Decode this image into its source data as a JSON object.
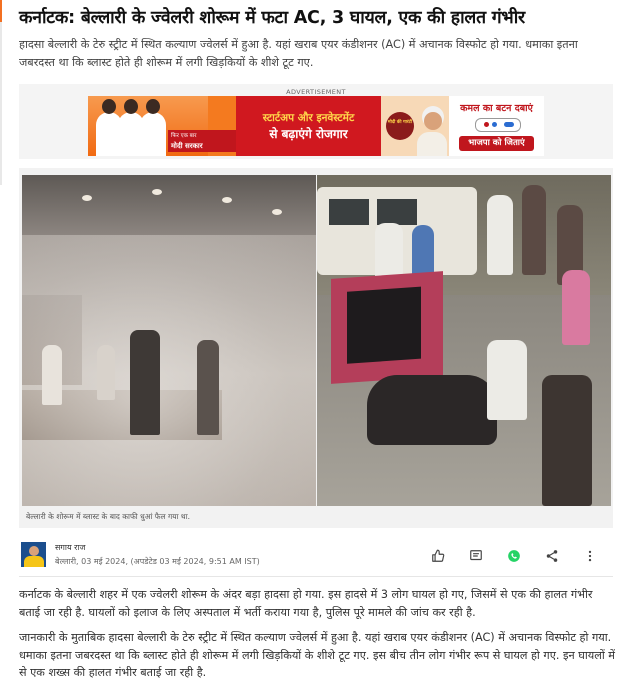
{
  "article": {
    "headline": "कर्नाटक: बेल्लारी के ज्वेलरी शोरूम में फटा AC, 3 घायल, एक की हालत गंभीर",
    "summary": "हादसा बेल्लारी के टेरु स्ट्रीट में स्थित कल्याण ज्वेलर्स में हुआ है. यहां खराब एयर कंडीशनर (AC) में अचानक विस्फोट हो गया. धमाका इतना जबरदस्त था कि ब्लास्ट होते ही शोरूम में लगी खिड़कियों के शीशे टूट गए.",
    "image_caption": "बेल्लारी के शोरूम में ब्लास्ट के बाद काफी धुआं फैल गया था.",
    "author": "सगाय राज",
    "dateline": "बेल्लारी, 03 मई 2024, (अपडेटेड 03 मई 2024, 9:51 AM IST)",
    "paragraphs": [
      "कर्नाटक के बेल्लारी शहर में एक ज्वेलरी शोरूम के अंदर बड़ा हादसा हो गया. इस हादसे में 3 लोग घायल हो गए, जिसमें से एक की हालत गंभीर बताई जा रही है. घायलों को इलाज के लिए अस्पताल में भर्ती कराया गया है, पुलिस पूरे मामले की जांच कर रही है.",
      "जानकारी के मुताबिक हादसा बेल्लारी के टेरु स्ट्रीट में स्थित कल्याण ज्वेलर्स में हुआ है. यहां खराब एयर कंडीशनर (AC) में अचानक विस्फोट हो गया. धमाका इतना जबरदस्त था कि ब्लास्ट होते ही शोरूम में लगी खिड़कियों के शीशे टूट गए. इस बीच तीन लोग गंभीर रूप से घायल हो गए. इन घायलों में से एक शख्स की हालत गंभीर बताई जा रही है."
    ]
  },
  "ad": {
    "label": "ADVERTISEMENT",
    "tagline_small": "फिर एक बार",
    "tagline_main": "मोदी सरकार",
    "center_line1": "स्टार्टअप और इनवेस्टमेंट",
    "center_line2": "से बढ़ाएंगे रोजगार",
    "badge_text": "मोदी की गारंटी",
    "right_top": "कमल का बटन दबाएं",
    "right_bottom": "भाजपा को जिताएं"
  },
  "actions": [
    {
      "icon": "thumbs-up-icon"
    },
    {
      "icon": "comment-icon"
    },
    {
      "icon": "whatsapp-icon"
    },
    {
      "icon": "share-icon"
    },
    {
      "icon": "more-vertical-icon"
    }
  ],
  "colors": {
    "accent": "#f37021",
    "ad_red": "#c0161d",
    "whatsapp": "#25d366"
  }
}
